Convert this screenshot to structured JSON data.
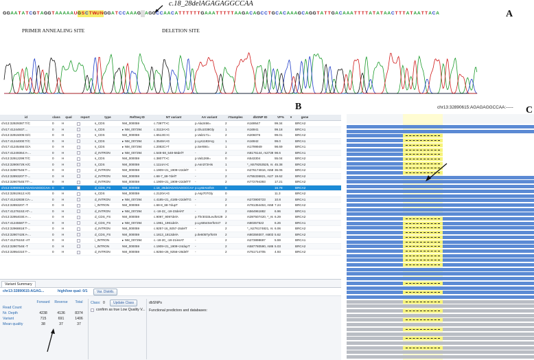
{
  "panel_a": {
    "label": "A",
    "mutation": "c.18_28delAGAGAGGCCAA",
    "primer_label": "PRIMER ANNEALING SITE",
    "deletion_label": "DELETION SITE",
    "sequence": "GGAATATCGTAGGTAAAAAUGSCTWUNGGATCCAAAG AGGCCAACATTTTTTGAAATTTTTAAGACAGCCTGCACAAAGCAGGTATTGACAAATTTTATATAACTTTATAATTACA"
  },
  "panel_b": {
    "label": "B",
    "columns": [
      "id",
      "class",
      "qual",
      "report",
      "type",
      "RefSeq ID",
      "NT variant",
      "AA variant",
      "#Samples",
      "dbSNP ID",
      "VF%",
      "▾",
      "gene"
    ],
    "rows": [
      [
        "chr13:32929387:T/C",
        "0",
        "H",
        "",
        "s_CDS",
        "NM_000059",
        "c.7397T>C",
        "p.Ala2466=",
        "2",
        "rs169547",
        "99.34",
        "",
        "BRCA2"
      ],
      [
        "chr17:41244937:...",
        "0",
        "H",
        "",
        "s_CDS",
        "▸ NM_007294",
        "c.3113A>G",
        "p.Glu1038Gly",
        "1",
        "rs16941",
        "99.18",
        "",
        "BRCA1"
      ],
      [
        "chr13:32915005:G/C",
        "0",
        "H",
        "",
        "s_CDS",
        "NM_000059",
        "c.6513G>C",
        "p.Val2171=",
        "2",
        "rs206076",
        "99.01",
        "",
        "BRCA2"
      ],
      [
        "chr17:41244000:T/C",
        "0",
        "H",
        "",
        "s_CDS",
        "▸ NM_007294",
        "c.3548A>G",
        "p.Lys1183Arg",
        "1",
        "rs16942",
        "99.0",
        "",
        "BRCA1"
      ],
      [
        "chr17:41245466:G/A",
        "0",
        "H",
        "",
        "s_CDS",
        "▸ NM_007294",
        "c.2082C>T",
        "p.Ser694=",
        "1",
        "rs1799949",
        "98.69",
        "",
        "BRCA1"
      ],
      [
        "chr17:41249364:A-...",
        "0",
        "H",
        "",
        "d_INTRON",
        "▸ NM_007294",
        "c.548-58_548-58delT",
        "-",
        "2",
        "rs8176144, rs27390...",
        "98.6",
        "",
        "BRCA1"
      ],
      [
        "chr13:32912299:T/C",
        "0",
        "H",
        "",
        "s_CDS",
        "NM_000059",
        "c.3807T>C",
        "p.Val1269=",
        "0",
        "rs543304",
        "55.04",
        "",
        "BRCA2"
      ],
      [
        "chr13:32906729:A/C",
        "0",
        "H",
        "",
        "s_CDS",
        "NM_000059",
        "c.1114A>C",
        "p.Asn372His",
        "1",
        "*_rs579253525, rs14...",
        "45.38",
        "",
        "BRCA2"
      ],
      [
        "chr13:32907546:T-...",
        "0",
        "H",
        "",
        "d_INTRON",
        "NM_000059",
        "c.1909+21_1909+22delT",
        "-",
        "1",
        "rs276174816, rs587...",
        "36.06",
        "",
        "BRCA2"
      ],
      [
        "chr13:32893207:T-...",
        "0",
        "H",
        "",
        "d_INTRON",
        "NM_000059",
        "c.68-7_68-7delT",
        "-",
        "2",
        "rs755336821, rs276...",
        "19.62",
        "",
        "BRCA2"
      ],
      [
        "chr13:32907545:TT-...",
        "0",
        "H",
        "",
        "d_INTRON",
        "NM_000059",
        "c.1909+21_1909+22delTT",
        "-",
        "2",
        "rs772794393",
        "17.21",
        "",
        "BRCA2"
      ],
      [
        "chr13:32890615:AGAGAGGCCAA-...",
        "0",
        "H",
        "",
        "d_CDS_FS",
        "NM_000059",
        "c.18_28delAGAGAGGCCAA",
        "p.Lys6AsnfsX",
        "0",
        "",
        "16.78",
        "",
        "BRCA2"
      ],
      [
        "chr13:32910612:A/G",
        "0",
        "H",
        "",
        "s_CDS",
        "NM_000059",
        "c.2120A>G",
        "p.Asp707Gly",
        "0",
        "",
        "11.3",
        "",
        "BRCA2"
      ],
      [
        "chr17:41242838:CA-...",
        "0",
        "H",
        "",
        "d_INTRON",
        "▸ NM_007294",
        "c.4185+21_4185+22delTG",
        "-",
        "2",
        "rs273900723",
        "10.8",
        "",
        "BRCA1"
      ],
      [
        "chr13:32893207:-T",
        "0",
        "H",
        "",
        "i_INTRON",
        "NM_000059",
        "c.68-8_68-7dupT",
        "-",
        "2",
        "rs781354453, rs587...",
        "7.24",
        "",
        "BRCA2"
      ],
      [
        "chr17:41276153:AT-...",
        "0",
        "H",
        "",
        "d_INTRON",
        "▸ NM_007294",
        "c.-18-22_-18-23delAT",
        "-",
        "2",
        "rs564961882",
        "6.96",
        "",
        "BRCA1"
      ],
      [
        "chr13:32954030:A-...",
        "0",
        "H",
        "",
        "d_CDS_FS",
        "NM_000059",
        "c.9097_9097delA",
        "p.Thr3033LeufsX29",
        "2",
        "rs397507420, *_rs8...",
        "6.29",
        "",
        "BRCA2"
      ],
      [
        "chr17:41245587:T-...",
        "0",
        "H",
        "",
        "d_CDS_FS",
        "▸ NM_007294",
        "c.1961_1961delA",
        "p.Lys654SerfsX47",
        "2",
        "rs80357522",
        "6.26",
        "",
        "BRCA1"
      ],
      [
        "chr13:32968818:T-...",
        "0",
        "H",
        "",
        "d_INTRON",
        "NM_000059",
        "c.9257-16_9257-15delT",
        "-",
        "2",
        "*_rs276174821, rs2...",
        "6.06",
        "",
        "BRCA2"
      ],
      [
        "chr13:32907428:A-...",
        "0",
        "H",
        "",
        "d_CDS_FS",
        "NM_000059",
        "c.1813_1813delA",
        "p.Ile605TyrfsX9",
        "2",
        "rs80359307, rs8035...",
        "5.62",
        "",
        "BRCA2"
      ],
      [
        "chr17:41276153:-AT",
        "0",
        "H",
        "",
        "i_INTRON",
        "▸ NM_007294",
        "c.-18-20_-18-21insAT",
        "-",
        "2",
        "rs273898697",
        "5.59",
        "",
        "BRCA1"
      ],
      [
        "chr13:32907546:-T",
        "0",
        "H",
        "",
        "i_INTRON",
        "NM_000059",
        "c.1909+21_1909+24dupT",
        "-",
        "2",
        "rs587780590, rs864...",
        "5.03",
        "",
        "BRCA2"
      ],
      [
        "chr13:32954310:T-...",
        "0",
        "H",
        "",
        "d_INTRON",
        "NM_000059",
        "c.9256+26_9256+28delT",
        "-",
        "2",
        "rs751714705",
        "4.93",
        "",
        "BRCA2"
      ]
    ]
  },
  "variant_summary": {
    "tab": "Variant Summary",
    "variant_id": "chr13:32890615:AGAG...",
    "quality": "high/low qual: 0/1",
    "distrib_button": "Var. Distrib.",
    "col_headers": [
      "Forward",
      "Reverse",
      "Total"
    ],
    "stats": [
      {
        "label": "Read Count",
        "values": [
          "",
          "",
          ""
        ]
      },
      {
        "label": "Nr. Depth",
        "values": [
          "4238",
          "4136",
          "8374"
        ]
      },
      {
        "label": "Variant",
        "values": [
          "715",
          "691",
          "1406"
        ]
      },
      {
        "label": "Mean quality",
        "values": [
          "38",
          "37",
          "37"
        ]
      }
    ],
    "class_label": "Class:",
    "class_value": "0",
    "update_button": "Update Class",
    "confirm_text": "confirm as true Low Quality V...",
    "dbsnp_label": "dbSNPs",
    "predictors_label": "Functional predictors and databases:"
  },
  "panel_c": {
    "label": "C",
    "header": "chr13:32890615:AGAGAGGCCAA:-----"
  },
  "colors": {
    "selected_row": "#1c8bd6",
    "read_blue": "#5b8ad4",
    "read_grey": "#b9bdc4",
    "deletion_yellow": "#f6f37a"
  }
}
